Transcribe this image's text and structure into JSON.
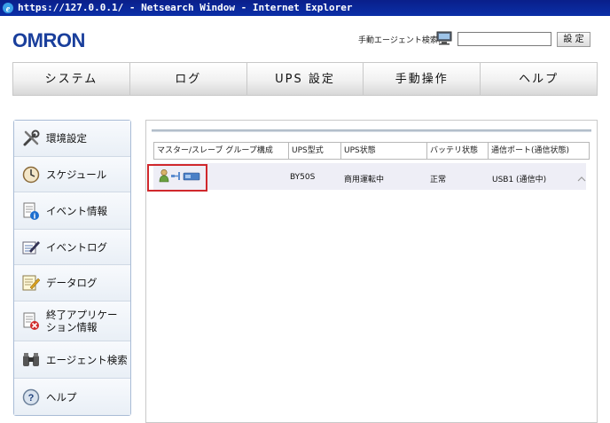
{
  "window": {
    "title": "https://127.0.0.1/ - Netsearch Window - Internet Explorer"
  },
  "header": {
    "logo": "OMRON",
    "agent_search_label": "手動エージェント検索:",
    "agent_search_value": "",
    "agent_search_button": "設 定"
  },
  "nav": {
    "tabs": [
      {
        "label": "システム"
      },
      {
        "label": "ログ"
      },
      {
        "label": "UPS 設定"
      },
      {
        "label": "手動操作"
      },
      {
        "label": "ヘルプ"
      }
    ]
  },
  "sidebar": {
    "items": [
      {
        "label": "環境設定",
        "icon": "tools-icon"
      },
      {
        "label": "スケジュール",
        "icon": "clock-icon"
      },
      {
        "label": "イベント情報",
        "icon": "document-info-icon"
      },
      {
        "label": "イベントログ",
        "icon": "log-edit-icon"
      },
      {
        "label": "データログ",
        "icon": "data-log-icon"
      },
      {
        "label": "終了アプリケーション情報",
        "label_line1": "終了アプリケー",
        "label_line2": "ション情報",
        "icon": "document-close-icon"
      },
      {
        "label": "エージェント検索",
        "icon": "binoculars-icon"
      },
      {
        "label": "ヘルプ",
        "icon": "help-icon"
      }
    ]
  },
  "table": {
    "headers": [
      "マスター/スレーブ グループ構成",
      "UPS型式",
      "UPS状態",
      "バッテリ状態",
      "通信ポート(通信状態)"
    ],
    "rows": [
      {
        "group_icons": "user-plug-ups-icons",
        "model": "BY50S",
        "status": "商用運転中",
        "battery": "正常",
        "port": "USB1 (通信中)"
      }
    ]
  },
  "colors": {
    "highlight": "#d0282c",
    "logo": "#1a3f9c",
    "titlebar": "#0b2fa8"
  }
}
